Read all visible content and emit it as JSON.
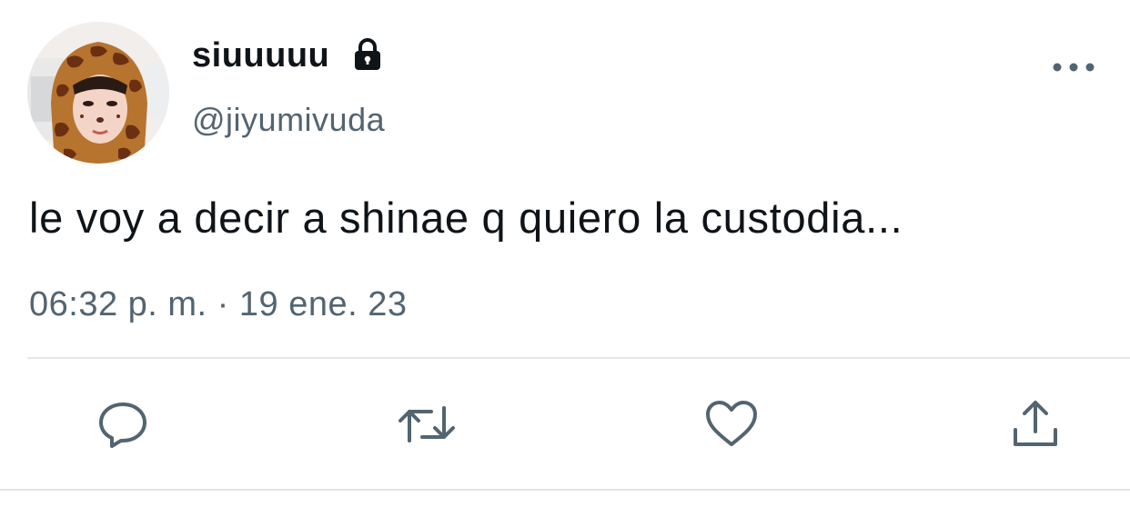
{
  "tweet": {
    "author": {
      "display_name": "siuuuuu",
      "handle": "@jiyumivuda",
      "protected_icon": "lock-icon",
      "avatar": "profile-photo"
    },
    "text": "le voy a decir a shinae q quiero la custodia...",
    "timestamp": "06:32 p. m. · 19 ene. 23",
    "menu_icon": "more-horizontal-icon"
  },
  "actions": [
    {
      "name": "reply",
      "icon": "reply-icon"
    },
    {
      "name": "retweet",
      "icon": "retweet-icon"
    },
    {
      "name": "like",
      "icon": "heart-icon"
    },
    {
      "name": "share",
      "icon": "share-icon"
    }
  ],
  "colors": {
    "text_primary": "#0f1419",
    "text_secondary": "#536471",
    "icon": "#536471",
    "divider": "#e3e7ea"
  }
}
